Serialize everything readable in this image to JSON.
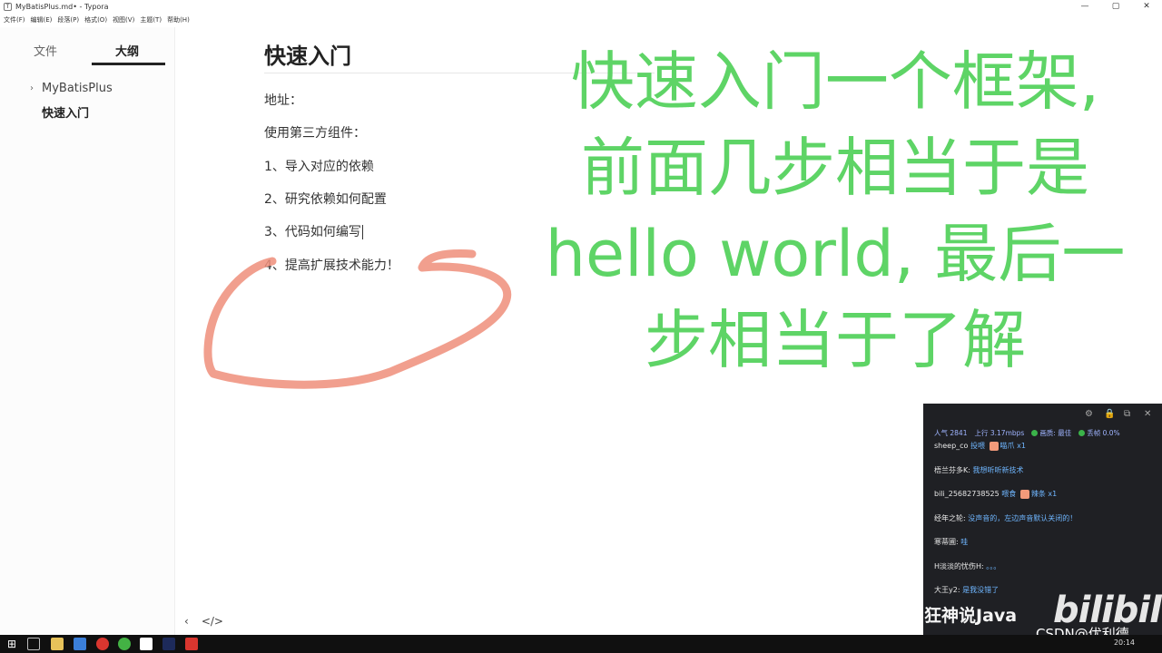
{
  "window": {
    "title": "MyBatisPlus.md• - Typora",
    "controls": [
      "—",
      "▢",
      "✕"
    ]
  },
  "menu": [
    "文件(F)",
    "编辑(E)",
    "段落(P)",
    "格式(O)",
    "视图(V)",
    "主题(T)",
    "帮助(H)"
  ],
  "sidebar": {
    "tabs": {
      "files": "文件",
      "outline": "大纲"
    },
    "outline": [
      {
        "label": "MyBatisPlus",
        "chevron": "›"
      },
      {
        "label": "快速入门"
      }
    ]
  },
  "document": {
    "heading": "快速入门",
    "paragraphs": [
      "地址：",
      "使用第三方组件：",
      "1、导入对应的依赖",
      "2、研究依赖如何配置",
      "3、代码如何编写",
      "4、提高扩展技术能力！"
    ],
    "footer": {
      "back": "‹",
      "source": "</>"
    }
  },
  "overlay": {
    "lines": [
      "快速入门一个框架,",
      "前面几步相当于是",
      "hello world, 最后一",
      "步相当于了解"
    ],
    "color": "#5ed466"
  },
  "annotation": {
    "stroke": "#ef8e7a"
  },
  "live_chat": {
    "stats": {
      "popularity": "人气 2841",
      "upload": "上行 3.17mbps",
      "quality": "画质: 最佳",
      "drop": "丢帧 0.0%"
    },
    "messages": [
      {
        "user": "sheep_co",
        "text": "投喂 ",
        "extra": "喵爪 x1",
        "gift": true
      },
      {
        "user": "梧兰芬多K:",
        "text": "我想听听新技术"
      },
      {
        "user": "bili_25682738525",
        "text": "喂食 ",
        "extra": "辣条 x1",
        "gift": true
      },
      {
        "user": "经年之轮:",
        "text": "没声音的，左边声音默认关闭的！"
      },
      {
        "user": "寒蒂圃:",
        "text": "哇"
      },
      {
        "user": "H淡淡的忧伤H:",
        "text": "。。。"
      },
      {
        "user": "大王y2:",
        "text": "是我没错了"
      }
    ]
  },
  "watermark": {
    "channel": "狂神说Java",
    "logo": "bilibili",
    "csdn": "CSDN@优利德"
  },
  "taskbar": {
    "time": "20:14"
  }
}
